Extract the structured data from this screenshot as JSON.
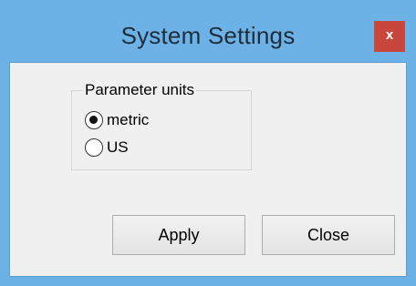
{
  "window": {
    "title": "System Settings",
    "close_glyph": "x",
    "frame_color": "#6cb2e6",
    "close_color": "#c9463c"
  },
  "parameter_units": {
    "legend": "Parameter units",
    "options": [
      {
        "label": "metric",
        "selected": true
      },
      {
        "label": "US",
        "selected": false
      }
    ]
  },
  "buttons": {
    "apply_label": "Apply",
    "close_label": "Close"
  }
}
